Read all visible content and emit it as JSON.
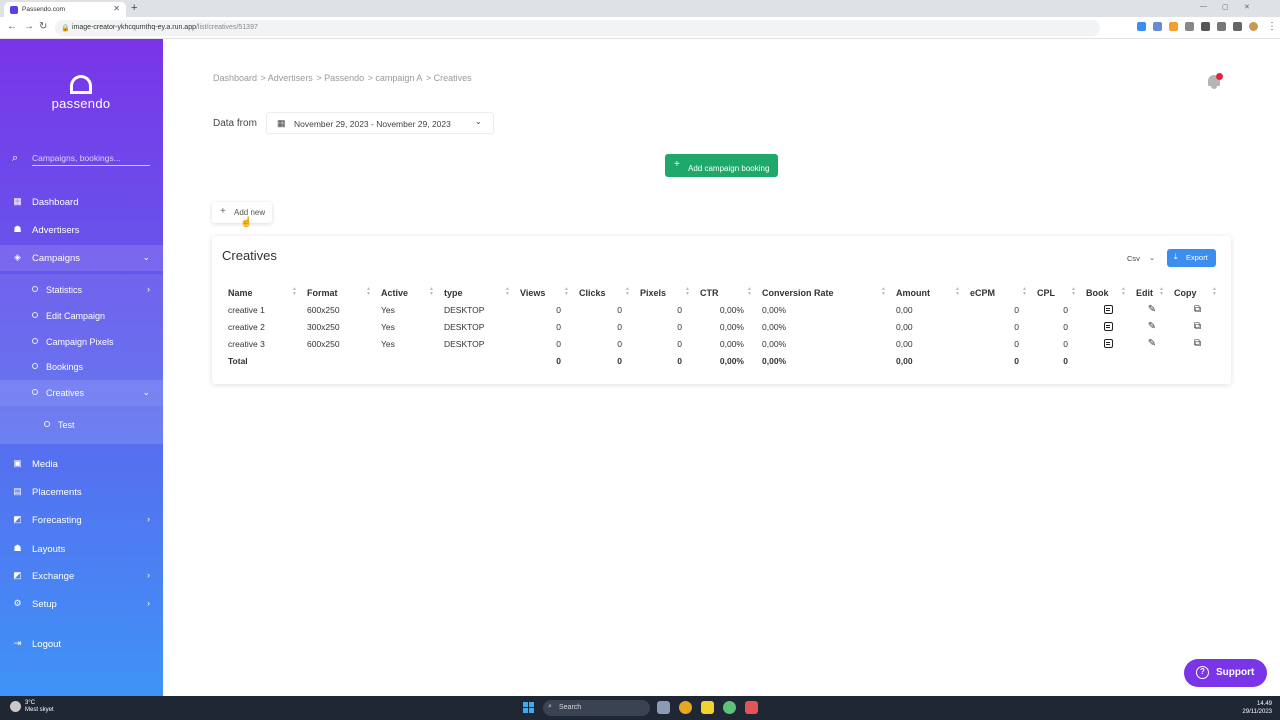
{
  "browser": {
    "tab_title": "Passendo.com",
    "url_host": "image-creator-ykhcqumthq-ey.a.run.app",
    "url_path": "/list/creatives/51397"
  },
  "sidebar": {
    "logo_text": "passendo",
    "search_placeholder": "Campaigns, bookings...",
    "items": [
      {
        "label": "Dashboard",
        "icon": "dashboard-icon"
      },
      {
        "label": "Advertisers",
        "icon": "advertisers-icon"
      },
      {
        "label": "Campaigns",
        "icon": "layers-icon"
      },
      {
        "label": "Media",
        "icon": "media-icon"
      },
      {
        "label": "Placements",
        "icon": "document-icon"
      },
      {
        "label": "Forecasting",
        "icon": "forecast-icon"
      },
      {
        "label": "Layouts",
        "icon": "layouts-icon"
      },
      {
        "label": "Exchange",
        "icon": "exchange-icon"
      },
      {
        "label": "Setup",
        "icon": "gear-icon"
      },
      {
        "label": "Logout",
        "icon": "logout-icon"
      }
    ],
    "campaign_sub": [
      {
        "label": "Statistics"
      },
      {
        "label": "Edit Campaign"
      },
      {
        "label": "Campaign Pixels"
      },
      {
        "label": "Bookings"
      },
      {
        "label": "Creatives"
      }
    ],
    "creatives_sub": [
      {
        "label": "Test"
      }
    ]
  },
  "breadcrumb": [
    "Dashboard",
    "Advertisers",
    "Passendo",
    "campaign A",
    "Creatives"
  ],
  "filter": {
    "label": "Data from",
    "date_range": "November 29, 2023 - November 29, 2023"
  },
  "buttons": {
    "add_campaign_booking": "Add campaign booking",
    "add_new": "Add new",
    "export": "Export",
    "support": "Support"
  },
  "card": {
    "title": "Creatives",
    "format_select": "Csv"
  },
  "table": {
    "columns": [
      "Name",
      "Format",
      "Active",
      "type",
      "Views",
      "Clicks",
      "Pixels",
      "CTR",
      "Conversion Rate",
      "Amount",
      "eCPM",
      "CPL",
      "Book",
      "Edit",
      "Copy"
    ],
    "rows": [
      {
        "name": "creative 1",
        "format": "600x250",
        "active": "Yes",
        "type": "DESKTOP",
        "views": "0",
        "clicks": "0",
        "pixels": "0",
        "ctr": "0,00%",
        "conv": "0,00%",
        "amount": "0,00",
        "ecpm": "0",
        "cpl": "0"
      },
      {
        "name": "creative 2",
        "format": "300x250",
        "active": "Yes",
        "type": "DESKTOP",
        "views": "0",
        "clicks": "0",
        "pixels": "0",
        "ctr": "0,00%",
        "conv": "0,00%",
        "amount": "0,00",
        "ecpm": "0",
        "cpl": "0"
      },
      {
        "name": "creative 3",
        "format": "600x250",
        "active": "Yes",
        "type": "DESKTOP",
        "views": "0",
        "clicks": "0",
        "pixels": "0",
        "ctr": "0,00%",
        "conv": "0,00%",
        "amount": "0,00",
        "ecpm": "0",
        "cpl": "0"
      }
    ],
    "total": {
      "label": "Total",
      "views": "0",
      "clicks": "0",
      "pixels": "0",
      "ctr": "0,00%",
      "conv": "0,00%",
      "amount": "0,00",
      "ecpm": "0",
      "cpl": "0"
    }
  },
  "taskbar": {
    "temp": "3°C",
    "weather": "Mest skyet",
    "search": "Search",
    "time": "14.49",
    "date": "29/11/2023"
  },
  "colors": {
    "sidebar_top": "#7a35e8",
    "sidebar_bottom": "#3f93f7",
    "green_button": "#1ea86a",
    "export_button": "#3b8ef0",
    "support_button": "#7a35e8",
    "notification_dot": "#e0243a"
  }
}
